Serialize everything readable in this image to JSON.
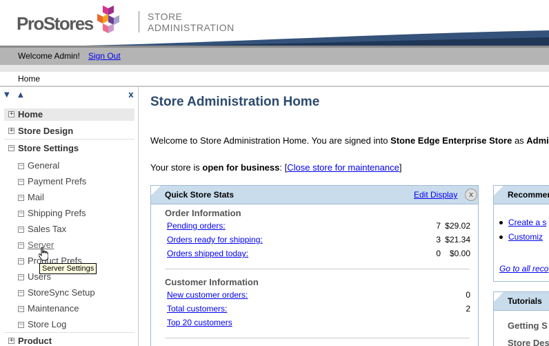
{
  "header": {
    "logo_text": "ProStores",
    "title_line1": "STORE",
    "title_line2": "ADMINISTRATION"
  },
  "welcome_bar": {
    "welcome_text": "Welcome Admin!",
    "sign_out": "Sign Out"
  },
  "breadcrumb": "Home",
  "sidebar": {
    "top_items": [
      {
        "label": "Home",
        "icon": "plus-box-icon"
      },
      {
        "label": "Store Design",
        "icon": "plus-box-icon"
      },
      {
        "label": "Store Settings",
        "icon": "minus-box-icon"
      }
    ],
    "sub_items": [
      {
        "label": "General"
      },
      {
        "label": "Payment Prefs"
      },
      {
        "label": "Mail"
      },
      {
        "label": "Shipping Prefs"
      },
      {
        "label": "Sales Tax"
      },
      {
        "label": "Server"
      },
      {
        "label": "Product Prefs"
      },
      {
        "label": "Users"
      },
      {
        "label": "StoreSync Setup"
      },
      {
        "label": "Maintenance"
      },
      {
        "label": "Store Log"
      }
    ],
    "bottom_item": {
      "label": "Product"
    },
    "tooltip": "Server Settings"
  },
  "main": {
    "title": "Store Administration Home",
    "welcome_prefix": "Welcome to Store Administration Home. You are signed into ",
    "store_name": "Stone Edge Enterprise Store",
    "welcome_mid": " as ",
    "user_name": "Admin",
    "welcome_suffix": ".",
    "status_prefix": "Your store is ",
    "status_value": "open for business",
    "status_colon": ": [",
    "close_store_link": "Close store for maintenance",
    "status_end": "]"
  },
  "quick_stats": {
    "title": "Quick Store Stats",
    "edit_display": "Edit Display",
    "close_glyph": "x",
    "order_section": "Order Information",
    "orders": [
      {
        "label": "Pending orders:",
        "count": "7",
        "amount": "$29.02"
      },
      {
        "label": "Orders ready for shipping:",
        "count": "3",
        "amount": "$21.34"
      },
      {
        "label": "Orders shipped today:",
        "count": "0",
        "amount": "$0.00"
      }
    ],
    "customer_section": "Customer Information",
    "customers": [
      {
        "label": "New customer orders:",
        "value": "0"
      },
      {
        "label": "Total customers:",
        "value": "2"
      },
      {
        "label": "Top 20 customers",
        "value": ""
      }
    ]
  },
  "recommend": {
    "title": "Recommen",
    "items": [
      "Create a s",
      "Customiz"
    ],
    "go_all": "Go to all reco"
  },
  "tutorials": {
    "title": "Tutorials",
    "sub1": "Getting S",
    "sub2": "Store Des"
  }
}
